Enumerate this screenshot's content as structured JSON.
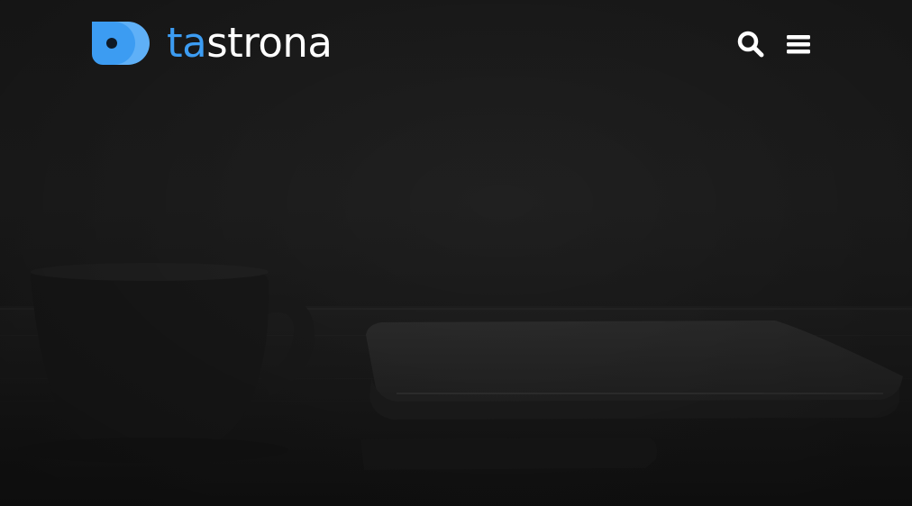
{
  "header": {
    "logo": {
      "text_accent": "ta",
      "text_rest": "strona"
    },
    "actions": [
      {
        "icon": "search-icon"
      },
      {
        "icon": "hamburger-menu-icon"
      }
    ]
  },
  "colors": {
    "background": "#1e1e1e",
    "brand_primary": "#3c9cf2",
    "brand_secondary": "#5fb0f7",
    "text": "#ffffff"
  }
}
